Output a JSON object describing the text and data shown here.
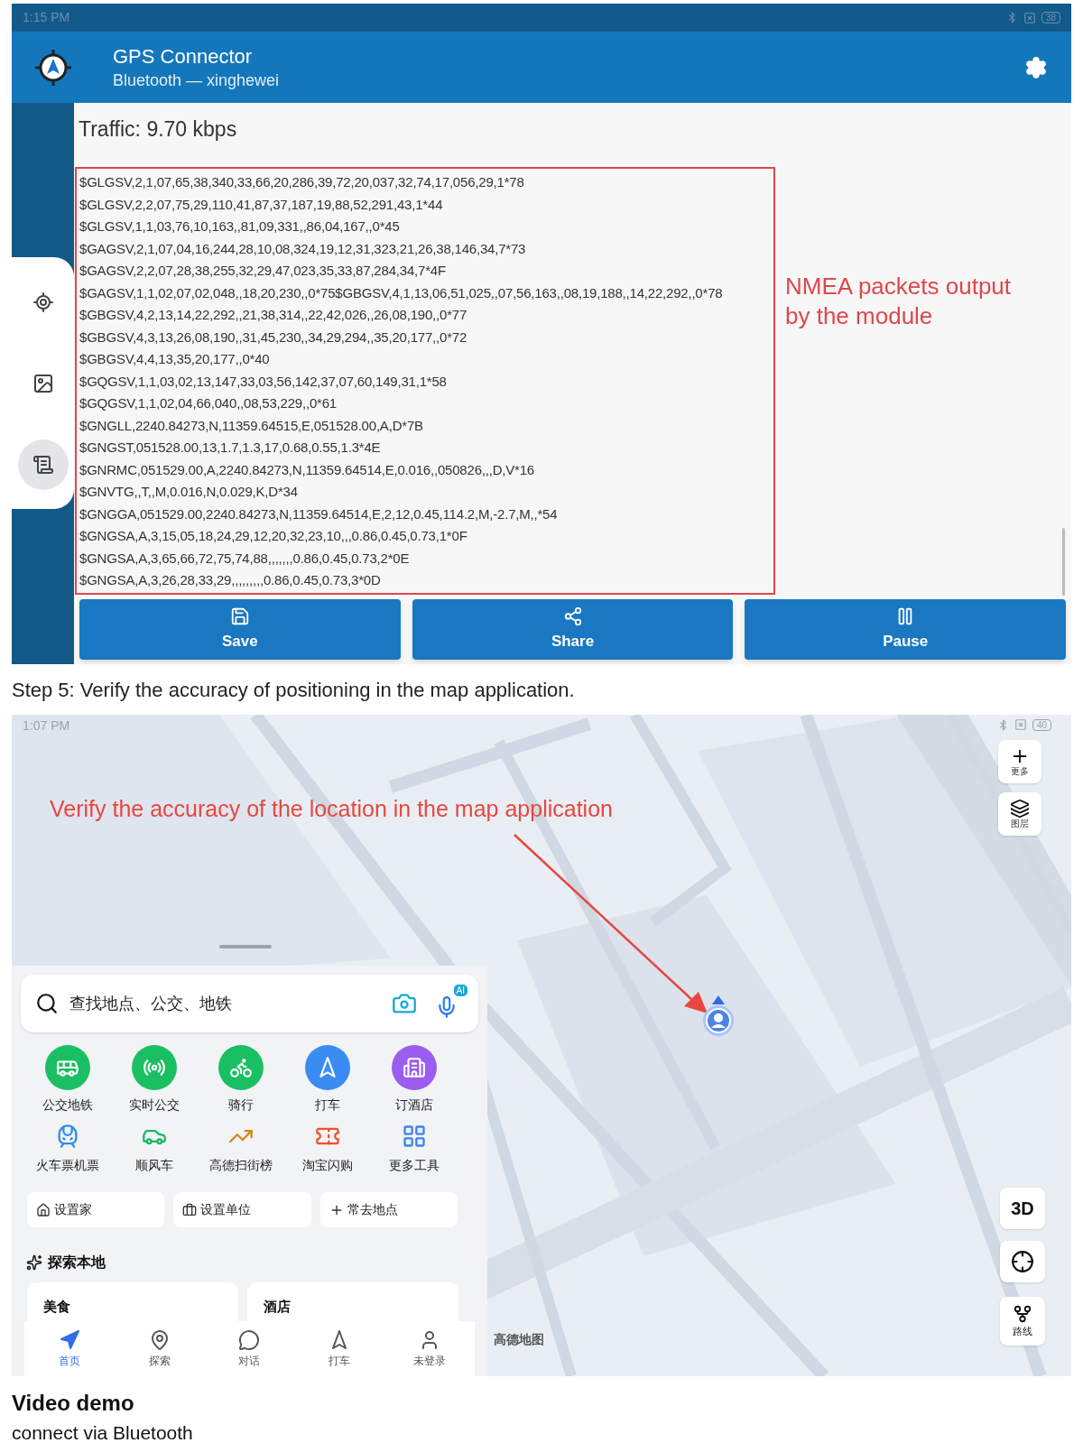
{
  "app_screenshot": {
    "status_bar": {
      "time": "1:15 PM",
      "battery": "38"
    },
    "app_bar": {
      "title": "GPS Connector",
      "subtitle": "Bluetooth — xinghewei"
    },
    "side_nav": [
      {
        "kind": "locate",
        "selected": false
      },
      {
        "kind": "gallery",
        "selected": false
      },
      {
        "kind": "log",
        "selected": true
      }
    ],
    "traffic": "Traffic: 9.70 kbps",
    "log_lines": [
      "$GLGSV,2,1,07,65,38,340,33,66,20,286,39,72,20,037,32,74,17,056,29,1*78",
      "$GLGSV,2,2,07,75,29,110,41,87,37,187,19,88,52,291,43,1*44",
      "$GLGSV,1,1,03,76,10,163,,81,09,331,,86,04,167,,0*45",
      "$GAGSV,2,1,07,04,16,244,28,10,08,324,19,12,31,323,21,26,38,146,34,7*73",
      "$GAGSV,2,2,07,28,38,255,32,29,47,023,35,33,87,284,34,7*4F",
      "$GAGSV,1,1,02,07,02,048,,18,20,230,,0*75$GBGSV,4,1,13,06,51,025,,07,56,163,,08,19,188,,14,22,292,,0*78",
      "$GBGSV,4,2,13,14,22,292,,21,38,314,,22,42,026,,26,08,190,,0*77",
      "$GBGSV,4,3,13,26,08,190,,31,45,230,,34,29,294,,35,20,177,,0*72",
      "$GBGSV,4,4,13,35,20,177,,0*40",
      "$GQGSV,1,1,03,02,13,147,33,03,56,142,37,07,60,149,31,1*58",
      "$GQGSV,1,1,02,04,66,040,,08,53,229,,0*61",
      "$GNGLL,2240.84273,N,11359.64515,E,051528.00,A,D*7B",
      "$GNGST,051528.00,13,1.7,1.3,17,0.68,0.55,1.3*4E",
      "$GNRMC,051529.00,A,2240.84273,N,11359.64514,E,0.016,,050826,,,D,V*16",
      "$GNVTG,,T,,M,0.016,N,0.029,K,D*34",
      "$GNGGA,051529.00,2240.84273,N,11359.64514,E,2,12,0.45,114.2,M,-2.7,M,,*54",
      "$GNGSA,A,3,15,05,18,24,29,12,20,32,23,10,,,0.86,0.45,0.73,1*0F",
      "$GNGSA,A,3,65,66,72,75,74,88,,,,,,,0.86,0.45,0.73,2*0E",
      "$GNGSA,A,3,26,28,33,29,,,,,,,,,0.86,0.45,0.73,3*0D"
    ],
    "annotation": "NMEA packets output by the module",
    "buttons": [
      {
        "kind": "save",
        "label": "Save"
      },
      {
        "kind": "share",
        "label": "Share"
      },
      {
        "kind": "pause",
        "label": "Pause"
      }
    ]
  },
  "caption": "Step 5: Verify the accuracy of positioning in the map application.",
  "map_screenshot": {
    "status_bar": {
      "time": "1:07 PM",
      "battery": "40"
    },
    "annotation": "Verify the accuracy of the location in the map application",
    "map_controls": [
      {
        "kind": "more",
        "label": "更多"
      },
      {
        "kind": "layers",
        "label": "图层"
      }
    ],
    "view_3d": "3D",
    "route_label": "路线",
    "map_logo": "高德地图",
    "search": {
      "placeholder": "查找地点、公交、地铁",
      "ai_badge": "AI"
    },
    "shortcuts": [
      {
        "kind": "bus",
        "label": "公交地铁"
      },
      {
        "kind": "realtime",
        "label": "实时公交"
      },
      {
        "kind": "cycling",
        "label": "骑行"
      },
      {
        "kind": "taxi",
        "label": "打车"
      },
      {
        "kind": "hotel",
        "label": "订酒店"
      },
      {
        "kind": "flight",
        "label": "火车票机票"
      },
      {
        "kind": "carpool",
        "label": "顺风车"
      },
      {
        "kind": "ranking",
        "label": "高德扫街榜"
      },
      {
        "kind": "groupbuy",
        "label": "淘宝闪购"
      },
      {
        "kind": "more",
        "label": "更多工具"
      }
    ],
    "quick_places": [
      {
        "kind": "home",
        "label": "设置家"
      },
      {
        "kind": "work",
        "label": "设置单位"
      },
      {
        "kind": "add",
        "label": "常去地点"
      }
    ],
    "explore_title": "探索本地",
    "explore_cards": [
      "美食",
      "酒店"
    ],
    "tabs": [
      {
        "kind": "home",
        "label": "首页",
        "selected": true
      },
      {
        "kind": "explore",
        "label": "探索",
        "selected": false
      },
      {
        "kind": "chat",
        "label": "对话",
        "selected": false
      },
      {
        "kind": "taxi",
        "label": "打车",
        "selected": false
      },
      {
        "kind": "account",
        "label": "未登录",
        "selected": false
      }
    ]
  },
  "heading": "Video demo",
  "body_text": "connect via Bluetooth"
}
